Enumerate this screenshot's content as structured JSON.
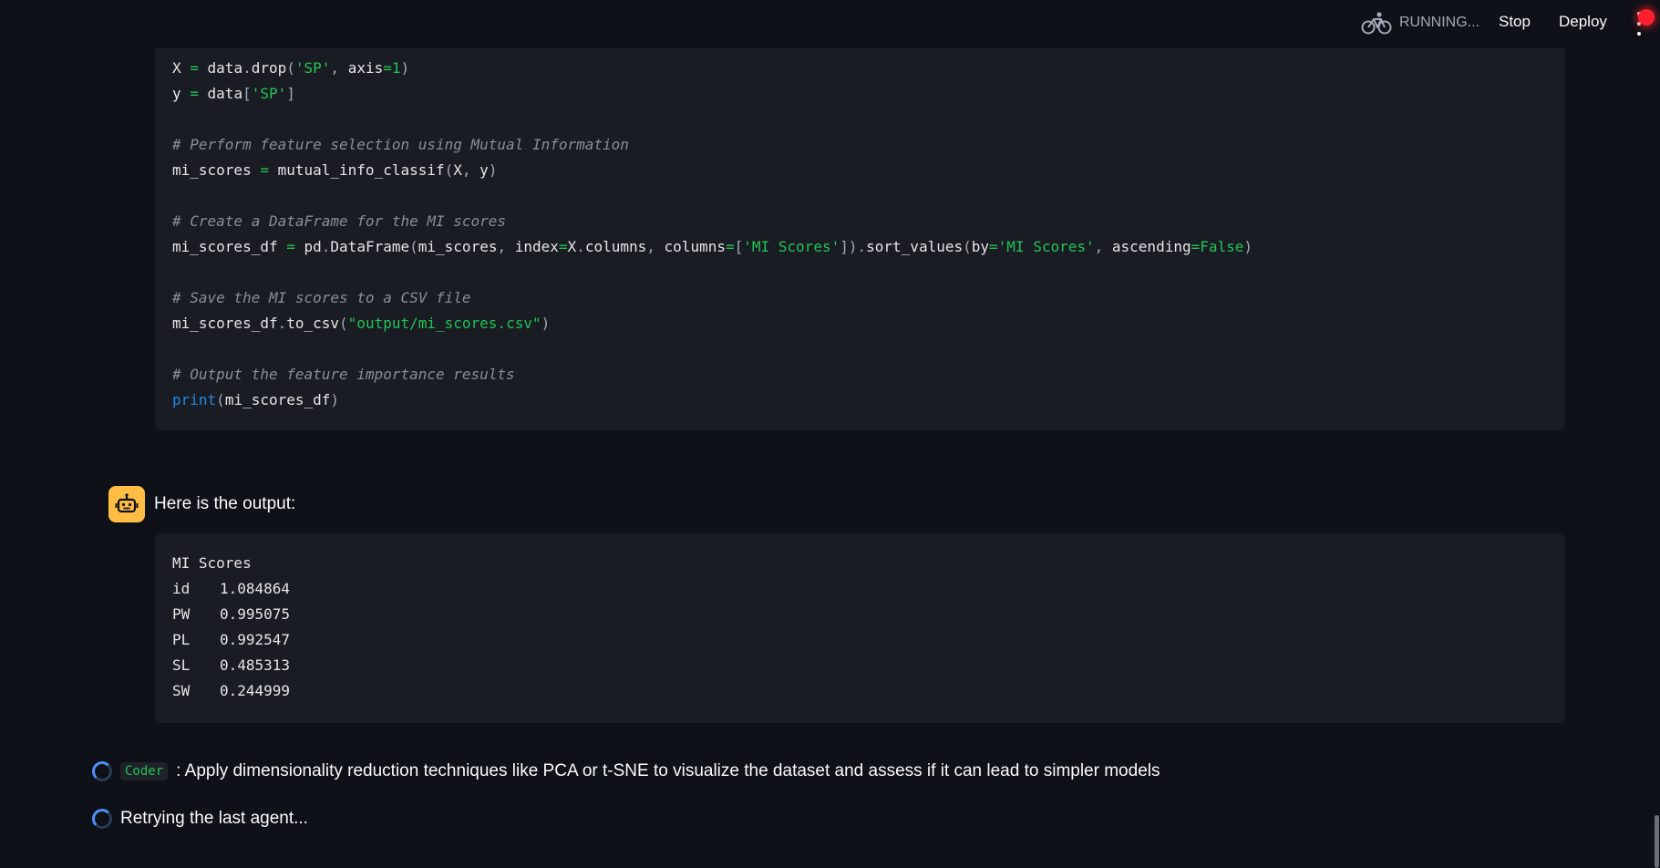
{
  "header": {
    "status_text": "RUNNING...",
    "stop_label": "Stop",
    "deploy_label": "Deploy"
  },
  "code_block": {
    "lines": [
      "X = data.drop('SP', axis=1)",
      "y = data['SP']",
      "",
      "# Perform feature selection using Mutual Information",
      "mi_scores = mutual_info_classif(X, y)",
      "",
      "# Create a DataFrame for the MI scores",
      "mi_scores_df = pd.DataFrame(mi_scores, index=X.columns, columns=['MI Scores']).sort_values(by='MI Scores', ascending=False)",
      "",
      "# Save the MI scores to a CSV file",
      "mi_scores_df.to_csv(\"output/mi_scores.csv\")",
      "",
      "# Output the feature importance results",
      "print(mi_scores_df)"
    ]
  },
  "assistant": {
    "message": "Here is the output:"
  },
  "output_block": {
    "header": "MI Scores",
    "rows": [
      {
        "feature": "id",
        "score": "1.084864"
      },
      {
        "feature": "PW",
        "score": "0.995075"
      },
      {
        "feature": "PL",
        "score": "0.992547"
      },
      {
        "feature": "SL",
        "score": "0.485313"
      },
      {
        "feature": "SW",
        "score": "0.244999"
      }
    ]
  },
  "steps": [
    {
      "agent": "Coder",
      "text": ": Apply dimensionality reduction techniques like PCA or t-SNE to visualize the dataset and assess if it can lead to simpler models"
    },
    {
      "text": "Retrying the last agent..."
    }
  ],
  "colors": {
    "background": "#0e1117",
    "code_background": "#1a1c24",
    "string": "#21c354",
    "keyword": "#1e88e5",
    "comment": "#8a8d98",
    "avatar": "#ffbd45",
    "record": "#ff1f2d"
  },
  "icons": [
    "bicycle-icon",
    "robot-icon",
    "kebab-menu-icon",
    "spinner-icon"
  ]
}
